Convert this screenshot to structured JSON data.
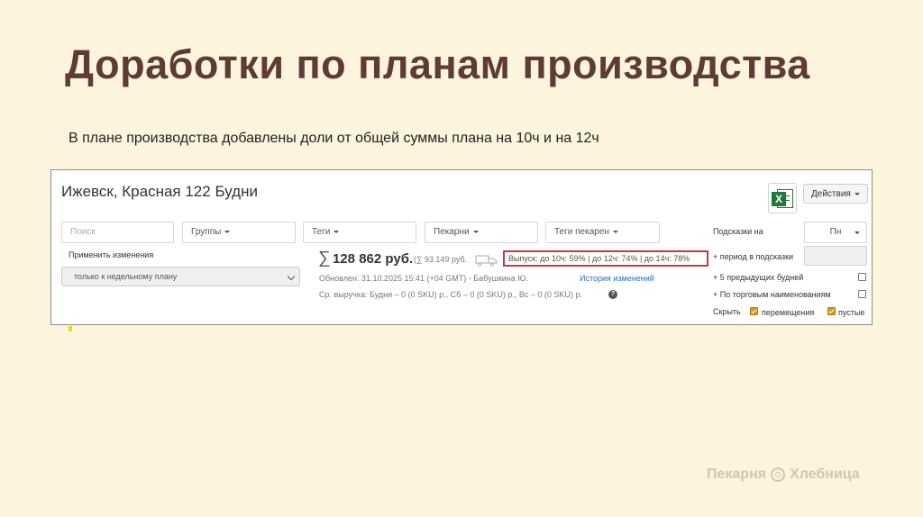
{
  "slide": {
    "title": "Доработки по планам производства",
    "subtitle": "В плане производства добавлены доли от общей суммы плана на 10ч и на 12ч",
    "brand_left": "Пекарня",
    "brand_right": "Хлебница"
  },
  "app": {
    "heading": "Ижевск, Красная 122 Будни",
    "actions_button": "Действия",
    "excel_icon": "excel-icon",
    "filters": {
      "search_placeholder": "Поиск",
      "groups": "Группы",
      "tags": "Теги",
      "bakeries": "Пекарни",
      "bakery_tags": "Теги пекарен"
    },
    "apply_changes_label": "Применить изменения",
    "apply_select_value": "только к недельному плану",
    "summary": {
      "sum_sign": "∑",
      "amount": "128 862 руб.",
      "secondary": "(∑ 93 149 руб.",
      "output": "Выпуск: до 10ч: 59% | до 12ч: 74% | до 14ч: 78%"
    },
    "updated": "Обновлен: 31.10.2025 15:41 (+04 GMT) - Бабушкина Ю.",
    "history_link": "История изменений",
    "avg_revenue": "Ср. выручка: Будни – 0 (0 SKU) р., Сб – 0 (0 SKU) р., Вс – 0 (0 SKU) р.",
    "hints": {
      "label": "Подсказки на",
      "day_value": "Пн",
      "period_button": "+ период в подсказки",
      "prev_weekdays": "+ 5 предыдущих будней",
      "by_trade_names": "+ По торговым наименованиям",
      "hide_label": "Скрыть",
      "moves_label": "перемещения",
      "empty_label": "пустые"
    }
  }
}
